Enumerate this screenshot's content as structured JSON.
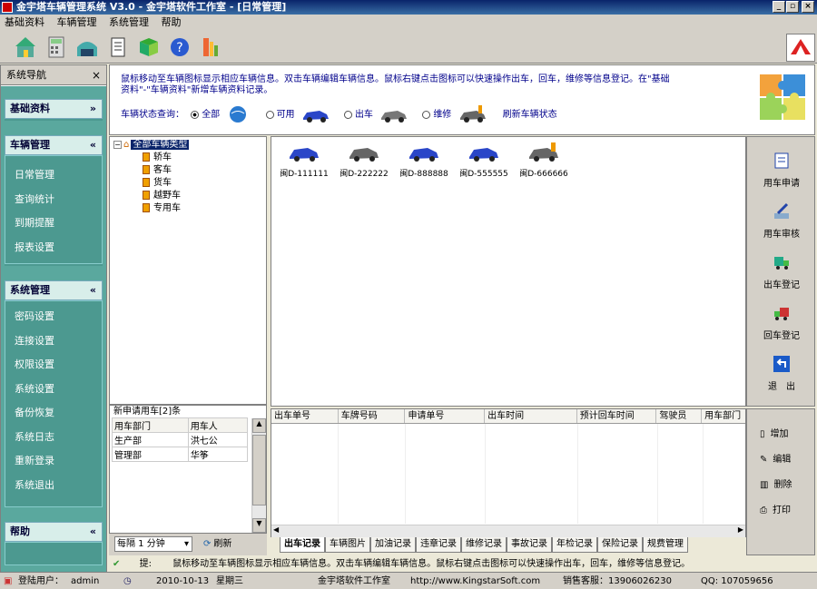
{
  "window": {
    "title": "金宇塔车辆管理系统 V3.0 - 金宇塔软件工作室 - [日常管理]"
  },
  "menu": [
    "基础资料",
    "车辆管理",
    "系统管理",
    "帮助"
  ],
  "toolbar": {
    "icons": [
      "home-icon",
      "calculator-icon",
      "garage-icon",
      "document-icon",
      "book-icon",
      "help-icon",
      "exit-icon"
    ]
  },
  "sidebar": {
    "title": "系统导航",
    "groups": [
      {
        "label": "基础资料",
        "items": []
      },
      {
        "label": "车辆管理",
        "items": [
          "日常管理",
          "查询统计",
          "到期提醒",
          "报表设置"
        ]
      },
      {
        "label": "系统管理",
        "items": [
          "密码设置",
          "连接设置",
          "权限设置",
          "系统设置",
          "备份恢复",
          "系统日志",
          "重新登录",
          "系统退出"
        ]
      },
      {
        "label": "帮助",
        "items": []
      }
    ]
  },
  "header": {
    "help_line1": "鼠标移动至车辆图标显示相应车辆信息。双击车辆编辑车辆信息。鼠标右键点击图标可以快速操作出车，回车，维修等信息登记。在\"基础",
    "help_line2": "资料\"-\"车辆资料\"新增车辆资料记录。",
    "filter_label": "车辆状态查询：",
    "options": [
      "全部",
      "可用",
      "出车",
      "维修"
    ],
    "selected": "全部",
    "refresh": "刷新车辆状态"
  },
  "tree": {
    "root": "全部车辆类型",
    "children": [
      "轿车",
      "客车",
      "货车",
      "越野车",
      "专用车"
    ]
  },
  "requests": {
    "title": "新申请用车[2]条",
    "columns": [
      "用车部门",
      "用车人"
    ],
    "rows": [
      [
        "生产部",
        "洪七公"
      ],
      [
        "管理部",
        "华筝"
      ]
    ]
  },
  "interval": {
    "value": "每隔 1 分钟",
    "refresh": "刷新"
  },
  "cars": [
    {
      "plate": "闽D-111111",
      "color": "#2a46c8"
    },
    {
      "plate": "闽D-222222",
      "color": "#666666"
    },
    {
      "plate": "闽D-888888",
      "color": "#2a46c8"
    },
    {
      "plate": "闽D-555555",
      "color": "#2a46c8"
    },
    {
      "plate": "闽D-666666",
      "color": "#666666"
    }
  ],
  "grid": {
    "columns": [
      "出车单号",
      "车牌号码",
      "申请单号",
      "出车时间",
      "预计回车时间",
      "驾驶员",
      "用车部门"
    ]
  },
  "tabs": [
    "出车记录",
    "车辆图片",
    "加油记录",
    "违章记录",
    "维修记录",
    "事故记录",
    "年检记录",
    "保险记录",
    "规费管理"
  ],
  "actions": [
    "用车申请",
    "用车审核",
    "出车登记",
    "回车登记",
    "退　出"
  ],
  "actions2": [
    "增加",
    "编辑",
    "删除",
    "打印"
  ],
  "hint": {
    "label": "提:",
    "text": "鼠标移动至车辆图标显示相应车辆信息。双击车辆编辑车辆信息。鼠标右键点击图标可以快速操作出车，回车，维修等信息登记。"
  },
  "status": {
    "user_label": "登陆用户：",
    "user": "admin",
    "date": "2010-10-13",
    "weekday": "星期三",
    "studio": "金宇塔软件工作室",
    "url": "http://www.KingstarSoft.com",
    "sales": "销售客服：13906026230",
    "qq": "QQ: 107059656"
  }
}
